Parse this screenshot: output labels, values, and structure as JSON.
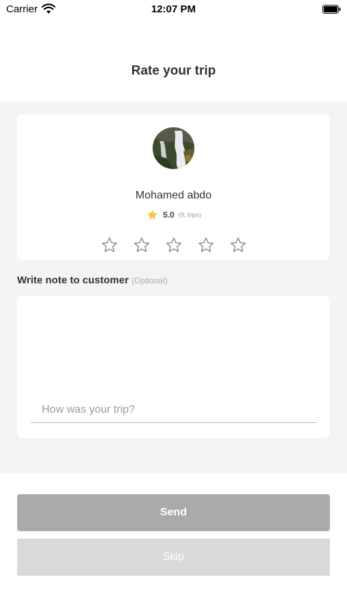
{
  "status_bar": {
    "carrier": "Carrier",
    "time": "12:07 PM",
    "wifi_icon": "wifi-icon",
    "battery_icon": "battery-icon"
  },
  "header": {
    "title": "Rate your trip"
  },
  "driver": {
    "avatar_icon": "waterfall-photo",
    "name": "Mohamed abdo",
    "rating": "5.0",
    "trips": "(9, trips)",
    "rating_icon": "star-filled-icon",
    "rating_icon_color": "#f5c53b"
  },
  "rating_input": {
    "max_stars": 5,
    "selected": 0,
    "star_icon": "star-outline-icon"
  },
  "note": {
    "label": "Write note to customer",
    "optional": "(Optional)",
    "placeholder": "How was your trip?",
    "value": ""
  },
  "actions": {
    "send_label": "Send",
    "skip_label": "Skip"
  },
  "colors": {
    "background": "#ffffff",
    "content_background": "#f4f4f4",
    "send_button": "#aaaaaa",
    "skip_button": "#d9d9d9",
    "star_filled": "#f5c53b",
    "star_outline": "#888888"
  }
}
